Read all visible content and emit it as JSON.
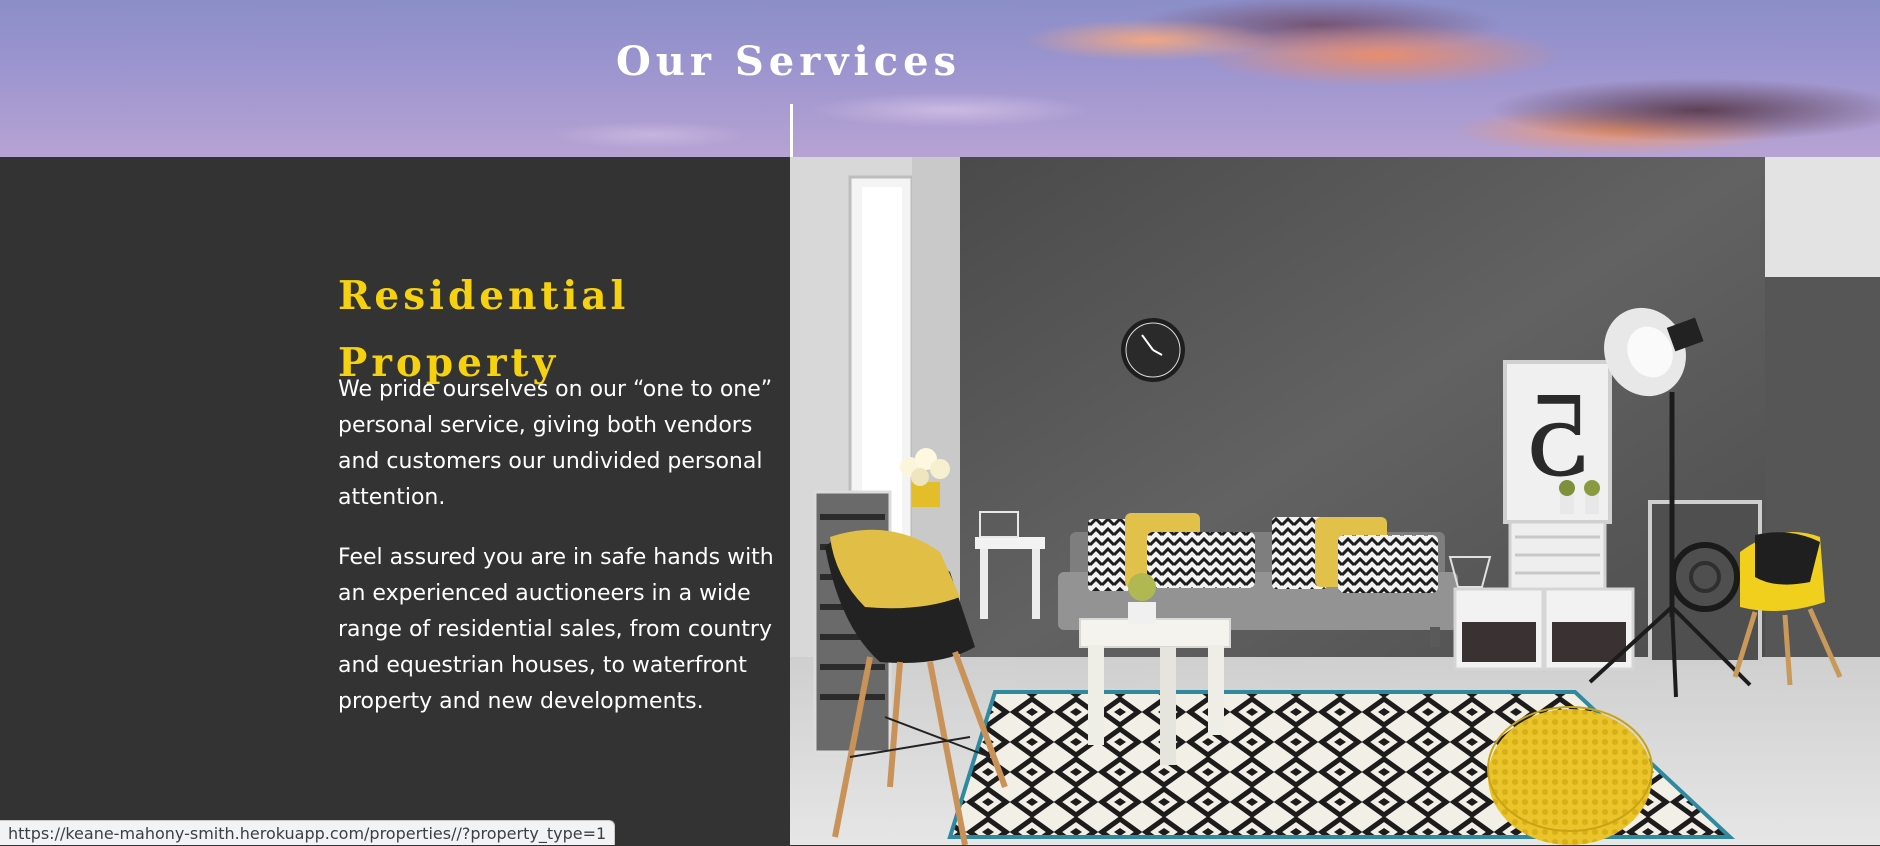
{
  "header": {
    "title": "Our Services"
  },
  "service": {
    "heading": "Residential Property",
    "paragraphs": [
      "We pride ourselves on our “one to one” personal service, giving both vendors and customers our undivided personal attention.",
      "Feel assured you are in safe hands with an experienced auctioneers in a wide range of residential sales, from country and equestrian houses, to waterfront property and new developments."
    ]
  },
  "photo": {
    "alt": "Residential living room interior"
  },
  "status_bar": {
    "url": "https://keane-mahony-smith.herokuapp.com/properties//?property_type=1"
  },
  "colors": {
    "accent": "#f6d10f",
    "panel": "#333333",
    "text": "#ffffff"
  }
}
